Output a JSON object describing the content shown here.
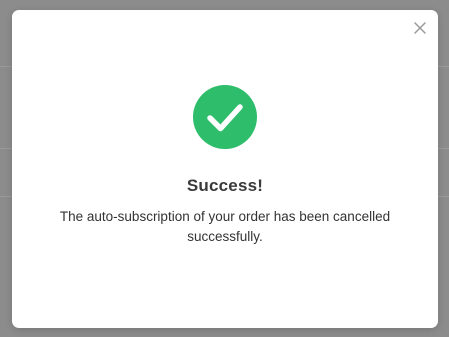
{
  "dialog": {
    "title": "Success!",
    "message": "The auto-subscription of your order has been cancelled successfully.",
    "close_icon": "close-icon",
    "status_icon": "check-circle-icon"
  },
  "colors": {
    "success": "#2ebd6b",
    "overlay": "#8c8c8c",
    "close": "#9a9a9a"
  }
}
